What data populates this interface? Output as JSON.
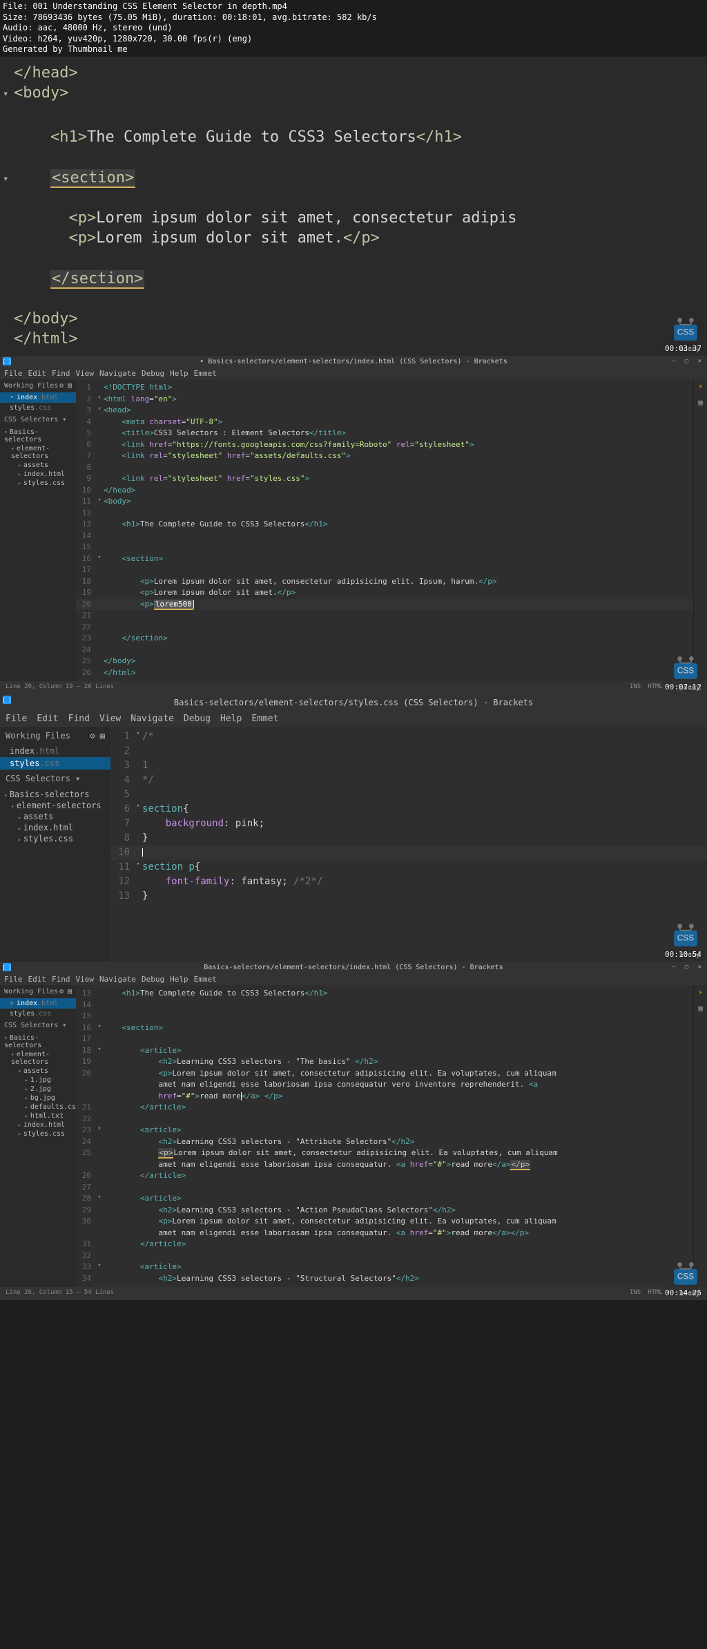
{
  "meta": {
    "file": "File: 001 Understanding CSS  Element Selector  in depth.mp4",
    "size": "Size: 78693436 bytes (75.05 MiB), duration: 00:18:01, avg.bitrate: 582 kb/s",
    "audio": "Audio: aac, 48000 Hz, stereo (und)",
    "video": "Video: h264, yuv420p, 1280x720, 30.00 fps(r) (eng)",
    "gen": "Generated by Thumbnail me"
  },
  "frame1": {
    "ts": "00:03:37",
    "lines": {
      "head_close": "</head>",
      "body_open": "<body>",
      "h1_open": "<h1>",
      "h1_text": "The Complete Guide to CSS3 Selectors",
      "h1_close": "</h1>",
      "section_open": "<section>",
      "p1_open": "<p>",
      "p1_text": "Lorem ipsum dolor sit amet, consectetur adipis",
      "p2_open": "<p>",
      "p2_text": "Lorem ipsum dolor sit amet.",
      "p2_close": "</p>",
      "section_close": "</section>",
      "body_close": "</body>",
      "html_close": "</html>"
    }
  },
  "frame2": {
    "title": "• Basics-selectors/element-selectors/index.html (CSS Selectors) - Brackets",
    "menu": [
      "File",
      "Edit",
      "Find",
      "View",
      "Navigate",
      "Debug",
      "Help",
      "Emmet"
    ],
    "working_files": "Working Files",
    "wf_items": [
      {
        "name": "index",
        "ext": ".html",
        "prefix": "dot",
        "sel": true
      },
      {
        "name": "styles",
        "ext": ".css",
        "prefix": "none",
        "sel": false
      }
    ],
    "project": "CSS Selectors  ▾",
    "tree": [
      {
        "label": "Basics-selectors",
        "open": true,
        "indent": 0
      },
      {
        "label": "element-selectors",
        "open": true,
        "indent": 1
      },
      {
        "label": "assets",
        "open": false,
        "indent": 2
      },
      {
        "label": "index.html",
        "open": false,
        "indent": 2,
        "file": true
      },
      {
        "label": "styles.css",
        "open": false,
        "indent": 2,
        "file": true
      }
    ],
    "code_lines": [
      {
        "n": 1,
        "fold": "",
        "html": "<span class='c-tag'>&lt;!DOCTYPE html&gt;</span>"
      },
      {
        "n": 2,
        "fold": "▾",
        "html": "<span class='c-tag'>&lt;html</span> <span class='c-attr'>lang</span>=<span class='c-val'>\"en\"</span><span class='c-tag'>&gt;</span>"
      },
      {
        "n": 3,
        "fold": "▾",
        "html": "<span class='c-tag'>&lt;head&gt;</span>"
      },
      {
        "n": 4,
        "fold": "",
        "html": "    <span class='c-tag'>&lt;meta</span> <span class='c-attr'>charset</span>=<span class='c-val'>\"UTF-8\"</span><span class='c-tag'>&gt;</span>"
      },
      {
        "n": 5,
        "fold": "",
        "html": "    <span class='c-tag'>&lt;title&gt;</span><span class='c-txt'>CSS3 Selectors : Element Selectors</span><span class='c-tag'>&lt;/title&gt;</span>"
      },
      {
        "n": 6,
        "fold": "",
        "html": "    <span class='c-tag'>&lt;link</span> <span class='c-attr'>href</span>=<span class='c-val'>\"https://fonts.googleapis.com/css?family=Roboto\"</span> <span class='c-attr'>rel</span>=<span class='c-val'>\"stylesheet\"</span><span class='c-tag'>&gt;</span>"
      },
      {
        "n": 7,
        "fold": "",
        "html": "    <span class='c-tag'>&lt;link</span> <span class='c-attr'>rel</span>=<span class='c-val'>\"stylesheet\"</span> <span class='c-attr'>href</span>=<span class='c-val'>\"assets/defaults.css\"</span><span class='c-tag'>&gt;</span>"
      },
      {
        "n": 8,
        "fold": "",
        "html": ""
      },
      {
        "n": 9,
        "fold": "",
        "html": "    <span class='c-tag'>&lt;link</span> <span class='c-attr'>rel</span>=<span class='c-val'>\"stylesheet\"</span> <span class='c-attr'>href</span>=<span class='c-val'>\"styles.css\"</span><span class='c-tag'>&gt;</span>"
      },
      {
        "n": 10,
        "fold": "",
        "html": "<span class='c-tag'>&lt;/head&gt;</span>"
      },
      {
        "n": 11,
        "fold": "▾",
        "html": "<span class='c-tag'>&lt;body&gt;</span>"
      },
      {
        "n": 12,
        "fold": "",
        "html": ""
      },
      {
        "n": 13,
        "fold": "",
        "html": "    <span class='c-tag'>&lt;h1&gt;</span><span class='c-txt'>The Complete Guide to CSS3 Selectors</span><span class='c-tag'>&lt;/h1&gt;</span>"
      },
      {
        "n": 14,
        "fold": "",
        "html": ""
      },
      {
        "n": 15,
        "fold": "",
        "html": ""
      },
      {
        "n": 16,
        "fold": "▾",
        "html": "    <span class='c-tag'>&lt;section&gt;</span>"
      },
      {
        "n": 17,
        "fold": "",
        "html": ""
      },
      {
        "n": 18,
        "fold": "",
        "html": "        <span class='c-tag'>&lt;p&gt;</span><span class='c-txt'>Lorem ipsum dolor sit amet, consectetur adipisicing elit. Ipsum, harum.</span><span class='c-tag'>&lt;/p&gt;</span>"
      },
      {
        "n": 19,
        "fold": "",
        "html": "        <span class='c-tag'>&lt;p&gt;</span><span class='c-txt'>Lorem ipsum dolor sit amet.</span><span class='c-tag'>&lt;/p&gt;</span>"
      },
      {
        "n": 20,
        "fold": "",
        "html": "        <span class='c-tag'>&lt;p&gt;</span><span class='emmet'>lorem500</span><span class='cursor'></span>",
        "active": true
      },
      {
        "n": 21,
        "fold": "",
        "html": ""
      },
      {
        "n": 22,
        "fold": "",
        "html": ""
      },
      {
        "n": 23,
        "fold": "",
        "html": "    <span class='c-tag'>&lt;/section&gt;</span>"
      },
      {
        "n": 24,
        "fold": "",
        "html": ""
      },
      {
        "n": 25,
        "fold": "",
        "html": "<span class='c-tag'>&lt;/body&gt;</span>"
      },
      {
        "n": 26,
        "fold": "",
        "html": "<span class='c-tag'>&lt;/html&gt;</span>"
      }
    ],
    "status_left": "Line 20, Column 19 — 26 Lines",
    "status_right": [
      "INS",
      "HTML ▾",
      "ⓘ",
      "␣ ▾"
    ],
    "ts": "00:07:12"
  },
  "frame3": {
    "title": "Basics-selectors/element-selectors/styles.css (CSS Selectors) - Brackets",
    "menu": [
      "File",
      "Edit",
      "Find",
      "View",
      "Navigate",
      "Debug",
      "Help",
      "Emmet"
    ],
    "working_files": "Working Files",
    "wf_items": [
      {
        "name": "index",
        "ext": ".html",
        "prefix": "none",
        "sel": false
      },
      {
        "name": "styles",
        "ext": ".css",
        "prefix": "none",
        "sel": true
      }
    ],
    "project": "CSS Selectors  ▾",
    "tree": [
      {
        "label": "Basics-selectors",
        "open": true,
        "indent": 0
      },
      {
        "label": "element-selectors",
        "open": true,
        "indent": 1
      },
      {
        "label": "assets",
        "open": false,
        "indent": 2
      },
      {
        "label": "index.html",
        "open": false,
        "indent": 2,
        "file": true
      },
      {
        "label": "styles.css",
        "open": false,
        "indent": 2,
        "file": true
      }
    ],
    "code_lines": [
      {
        "n": 1,
        "fold": "▾",
        "html": "<span class='c-com'>/*</span>"
      },
      {
        "n": 2,
        "fold": "",
        "html": ""
      },
      {
        "n": 3,
        "fold": "",
        "html": "<span class='c-com'>1</span>"
      },
      {
        "n": 4,
        "fold": "",
        "html": "<span class='c-com'>*/</span>"
      },
      {
        "n": 5,
        "fold": "",
        "html": ""
      },
      {
        "n": 6,
        "fold": "▾",
        "html": "<span class='c-tag'>section</span><span class='c-txt'>{</span>"
      },
      {
        "n": 7,
        "fold": "",
        "html": "    <span class='c-attr'>background</span><span class='c-txt'>: pink;</span>"
      },
      {
        "n": 8,
        "fold": "",
        "html": "<span class='c-txt'>}</span>"
      },
      {
        "n": 10,
        "fold": "",
        "html": "<span class='cursor'></span>",
        "active": true
      },
      {
        "n": 11,
        "fold": "▾",
        "html": "<span class='c-tag'>section p</span><span class='c-txt'>{</span>"
      },
      {
        "n": 12,
        "fold": "",
        "html": "    <span class='c-attr'>font-family</span><span class='c-txt'>: fantasy; </span><span class='c-com'>/*2*/</span>"
      },
      {
        "n": 13,
        "fold": "",
        "html": "<span class='c-txt'>}</span>"
      }
    ],
    "ts": "00:10:54"
  },
  "frame4": {
    "title": "Basics-selectors/element-selectors/index.html (CSS Selectors) - Brackets",
    "menu": [
      "File",
      "Edit",
      "Find",
      "View",
      "Navigate",
      "Debug",
      "Help",
      "Emmet"
    ],
    "working_files": "Working Files",
    "wf_items": [
      {
        "name": "index",
        "ext": ".html",
        "prefix": "x",
        "sel": true
      },
      {
        "name": "styles",
        "ext": ".css",
        "prefix": "none",
        "sel": false
      }
    ],
    "project": "CSS Selectors  ▾",
    "tree": [
      {
        "label": "Basics-selectors",
        "open": true,
        "indent": 0
      },
      {
        "label": "element-selectors",
        "open": true,
        "indent": 1
      },
      {
        "label": "assets",
        "open": true,
        "indent": 2
      },
      {
        "label": "1.jpg",
        "indent": 3,
        "file": true
      },
      {
        "label": "2.jpg",
        "indent": 3,
        "file": true
      },
      {
        "label": "bg.jpg",
        "indent": 3,
        "file": true
      },
      {
        "label": "defaults.css",
        "indent": 3,
        "file": true
      },
      {
        "label": "html.txt",
        "indent": 3,
        "file": true
      },
      {
        "label": "index.html",
        "indent": 2,
        "file": true
      },
      {
        "label": "styles.css",
        "indent": 2,
        "file": true
      }
    ],
    "code_lines": [
      {
        "n": 13,
        "fold": "",
        "html": "    <span class='c-tag'>&lt;h1&gt;</span><span class='c-txt'>The Complete Guide to CSS3 Selectors</span><span class='c-tag'>&lt;/h1&gt;</span>"
      },
      {
        "n": 14,
        "fold": "",
        "html": ""
      },
      {
        "n": 15,
        "fold": "",
        "html": ""
      },
      {
        "n": 16,
        "fold": "▾",
        "html": "    <span class='c-tag'>&lt;section&gt;</span>"
      },
      {
        "n": 17,
        "fold": "",
        "html": ""
      },
      {
        "n": 18,
        "fold": "▾",
        "html": "        <span class='c-tag'>&lt;article&gt;</span>"
      },
      {
        "n": 19,
        "fold": "",
        "html": "            <span class='c-tag'>&lt;h2&gt;</span><span class='c-txt'>Learning CSS3 selectors - \"The basics\" </span><span class='c-tag'>&lt;/h2&gt;</span>"
      },
      {
        "n": 20,
        "fold": "",
        "html": "            <span class='c-tag'>&lt;p&gt;</span><span class='c-txt'>Lorem ipsum dolor sit amet, consectetur adipisicing elit. Ea voluptates, cum aliquam</span>"
      },
      {
        "n": "",
        "fold": "",
        "html": "            <span class='c-txt'>amet nam eligendi esse laboriosam ipsa consequatur vero inventore reprehenderit. </span><span class='c-tag'>&lt;a</span>"
      },
      {
        "n": "",
        "fold": "",
        "html": "            <span class='c-attr'>href</span>=<span class='c-val'>\"#\"</span><span class='c-tag'>&gt;</span><span class='c-txt'>read more</span><span class='cursor'></span><span class='c-tag'>&lt;/a&gt; &lt;/p&gt;</span>"
      },
      {
        "n": 21,
        "fold": "",
        "html": "        <span class='c-tag'>&lt;/article&gt;</span>"
      },
      {
        "n": 22,
        "fold": "",
        "html": ""
      },
      {
        "n": 23,
        "fold": "▾",
        "html": "        <span class='c-tag'>&lt;article&gt;</span>"
      },
      {
        "n": 24,
        "fold": "",
        "html": "            <span class='c-tag'>&lt;h2&gt;</span><span class='c-txt'>Learning CSS3 selectors - \"Attribute Selectors\"</span><span class='c-tag'>&lt;/h2&gt;</span>"
      },
      {
        "n": 25,
        "fold": "",
        "html": "            <span class='hl-p'>&lt;p&gt;</span><span class='c-txt'>Lorem ipsum dolor sit amet, consectetur adipisicing elit. Ea voluptates, cum aliquam</span>"
      },
      {
        "n": "",
        "fold": "",
        "html": "            <span class='c-txt'>amet nam eligendi esse laboriosam ipsa consequatur. </span><span class='c-tag'>&lt;a</span> <span class='c-attr'>href</span>=<span class='c-val'>\"#\"</span><span class='c-tag'>&gt;</span><span class='c-txt'>read more</span><span class='c-tag'>&lt;/a&gt;</span><span class='hl-p'>&lt;/p&gt;</span>"
      },
      {
        "n": 26,
        "fold": "",
        "html": "        <span class='c-tag'>&lt;/article&gt;</span>"
      },
      {
        "n": 27,
        "fold": "",
        "html": ""
      },
      {
        "n": 28,
        "fold": "▾",
        "html": "        <span class='c-tag'>&lt;article&gt;</span>"
      },
      {
        "n": 29,
        "fold": "",
        "html": "            <span class='c-tag'>&lt;h2&gt;</span><span class='c-txt'>Learning CSS3 selectors - \"Action PseudoClass Selectors\"</span><span class='c-tag'>&lt;/h2&gt;</span>"
      },
      {
        "n": 30,
        "fold": "",
        "html": "            <span class='c-tag'>&lt;p&gt;</span><span class='c-txt'>Lorem ipsum dolor sit amet, consectetur adipisicing elit. Ea voluptates, cum aliquam</span>"
      },
      {
        "n": "",
        "fold": "",
        "html": "            <span class='c-txt'>amet nam eligendi esse laboriosam ipsa consequatur. </span><span class='c-tag'>&lt;a</span> <span class='c-attr'>href</span>=<span class='c-val'>\"#\"</span><span class='c-tag'>&gt;</span><span class='c-txt'>read more</span><span class='c-tag'>&lt;/a&gt;&lt;/p&gt;</span>"
      },
      {
        "n": 31,
        "fold": "",
        "html": "        <span class='c-tag'>&lt;/article&gt;</span>"
      },
      {
        "n": 32,
        "fold": "",
        "html": ""
      },
      {
        "n": 33,
        "fold": "▾",
        "html": "        <span class='c-tag'>&lt;article&gt;</span>"
      },
      {
        "n": 34,
        "fold": "",
        "html": "            <span class='c-tag'>&lt;h2&gt;</span><span class='c-txt'>Learning CSS3 selectors - \"Structural Selectors\"</span><span class='c-tag'>&lt;/h2&gt;</span>"
      }
    ],
    "status_left": "Line 26, Column 15 — 54 Lines",
    "status_right": [
      "INS",
      "HTML ▾",
      "ⓘ",
      "␣ ▾"
    ],
    "ts": "00:14:25"
  }
}
